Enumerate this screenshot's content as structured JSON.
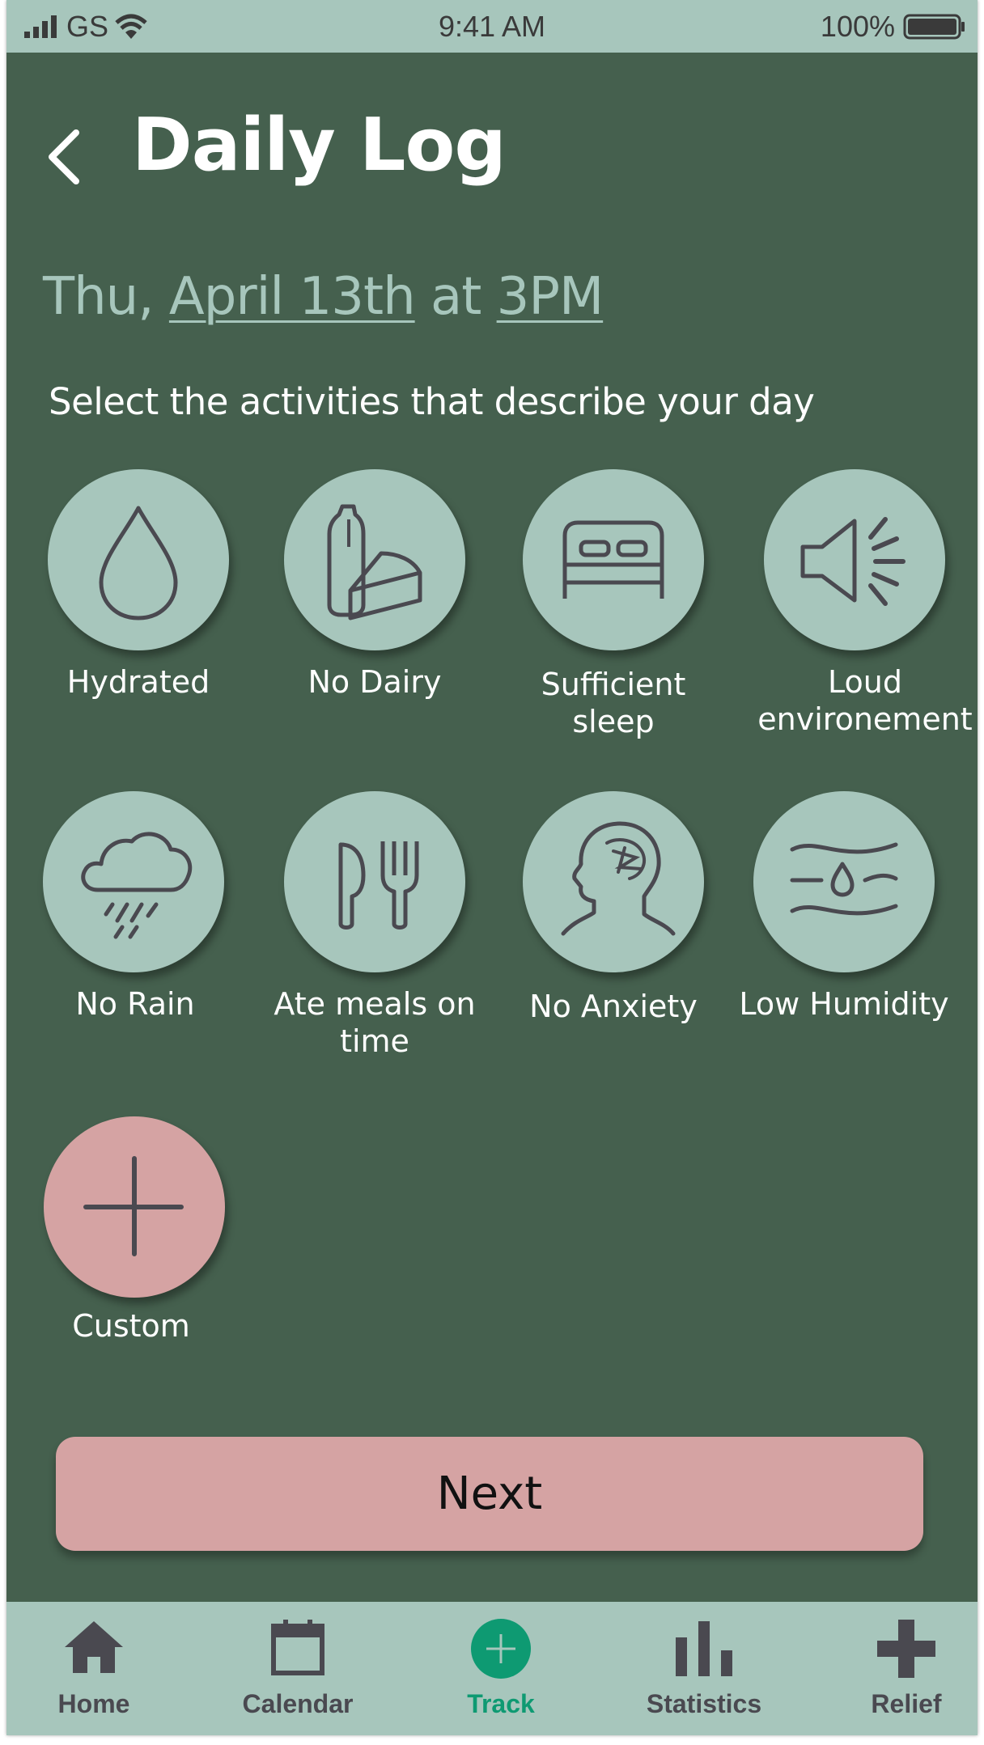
{
  "status_bar": {
    "carrier": "GS",
    "time": "9:41 AM",
    "battery": "100%"
  },
  "header": {
    "back_icon": "chevron-left-icon",
    "title": "Daily Log"
  },
  "date_line": {
    "prefix": "Thu, ",
    "date": "April 13th",
    "joiner": " at ",
    "time": "3PM"
  },
  "instruction": "Select the activities that describe your day",
  "activities": [
    {
      "label": "Hydrated",
      "icon": "water-drop-icon"
    },
    {
      "label": "No Dairy",
      "icon": "milk-cheese-icon"
    },
    {
      "label": "Sufficient sleep",
      "icon": "bed-icon"
    },
    {
      "label": "Loud environement",
      "icon": "megaphone-icon"
    },
    {
      "label": "No Rain",
      "icon": "rain-cloud-icon"
    },
    {
      "label": "Ate meals on time",
      "icon": "fork-knife-icon"
    },
    {
      "label": "No Anxiety",
      "icon": "anxious-head-icon"
    },
    {
      "label": "Low Humidity",
      "icon": "humidity-icon"
    },
    {
      "label": "Custom",
      "icon": "plus-icon"
    }
  ],
  "next_button": "Next",
  "tabs": [
    {
      "label": "Home",
      "icon": "home-icon"
    },
    {
      "label": "Calendar",
      "icon": "calendar-icon"
    },
    {
      "label": "Track",
      "icon": "track-plus-icon"
    },
    {
      "label": "Statistics",
      "icon": "bar-chart-icon"
    },
    {
      "label": "Relief",
      "icon": "cross-icon"
    }
  ],
  "colors": {
    "background": "#45604e",
    "accent_mint": "#a7c6bc",
    "accent_pink": "#d5a3a3",
    "active_tab": "#0e9a72",
    "icon_stroke": "#4a4950"
  }
}
